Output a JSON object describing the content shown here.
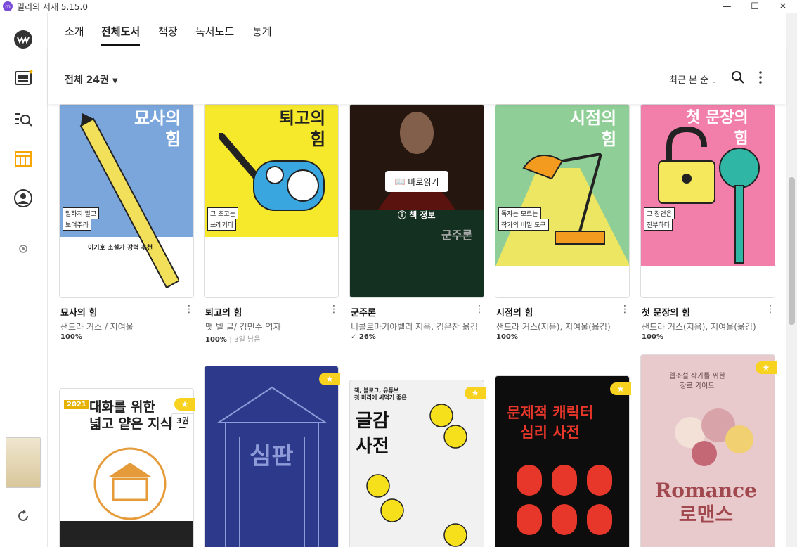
{
  "window": {
    "title": "밀리의 서재 5.15.0"
  },
  "nav": {
    "tabs": [
      "소개",
      "전체도서",
      "책장",
      "독서노트",
      "통계"
    ],
    "active": "전체도서"
  },
  "toolbar": {
    "count": "전체 24권",
    "sort": "최근 본 순"
  },
  "books_row1": [
    {
      "title": "묘사의 힘",
      "author": "샌드라 거스 / 지여울",
      "progress": "100%",
      "cover_title": "묘사의\n힘",
      "cover_tag1": "말하지 말고",
      "cover_tag2": "보여주라",
      "cover_sub": "이기호 소설가 강력 추천"
    },
    {
      "title": "퇴고의 힘",
      "author": "맷 벨 글/ 김민수 역자",
      "progress": "100%",
      "extra": "3일 남음",
      "cover_title": "퇴고의\n힘",
      "cover_tag1": "그 초고는",
      "cover_tag2": "쓰레기다"
    },
    {
      "title": "군주론",
      "author": "니콜로마키아벨리 지음, 김운찬 옮김",
      "progress": "26%",
      "cover_title": "군주론",
      "read_btn": "바로읽기",
      "info": "책 정보"
    },
    {
      "title": "시점의 힘",
      "author": "샌드라 거스(지음), 지여울(옮김)",
      "progress": "100%",
      "cover_title": "시점의\n힘",
      "cover_tag1": "독자는 모르는",
      "cover_tag2": "작가의 비밀 도구"
    },
    {
      "title": "첫 문장의 힘",
      "author": "샌드라 거스(지음), 지여울(옮김)",
      "progress": "100%",
      "cover_title": "첫 문장의\n힘",
      "cover_tag1": "그 장면은",
      "cover_tag2": "진부하다"
    }
  ],
  "books_row2": [
    {
      "cover_title": "대화를 위한\n넓고 얕은 지식 1",
      "badge": "2021",
      "volumes": "3권"
    },
    {
      "cover_title": "심판"
    },
    {
      "cover_title": "글감\n사전",
      "cover_sub": "책, 블로그, 유튜브\n첫 머리에 써먹기 좋은"
    },
    {
      "cover_title": "문제적 캐릭터\n심리 사전"
    },
    {
      "cover_title": "Romance\n로맨스",
      "cover_sub": "웹소설 작가를 위한\n장르 가이드"
    }
  ],
  "colors": {
    "accent": "#f7b500",
    "brand": "#7a4ad8"
  }
}
